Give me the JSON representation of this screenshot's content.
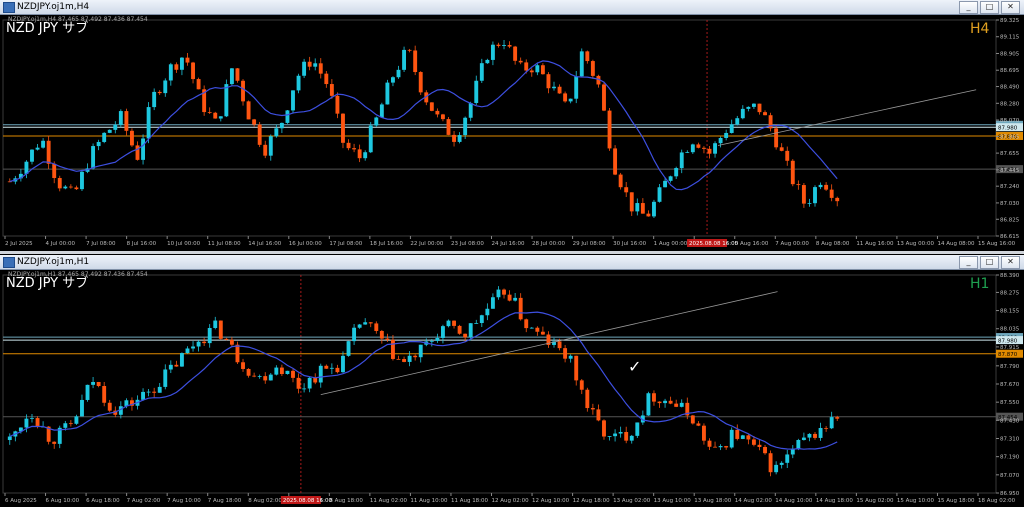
{
  "windows": [
    {
      "title": "NZDJPY.oj1m,H4",
      "buttons": [
        "_",
        "□",
        "✕"
      ],
      "chart_data": {
        "type": "candlestick",
        "info_line": "NZDJPY.oj1m,H4  87.465 87.492 87.436 87.454",
        "symbol_label": "NZD JPY サブ",
        "timeframe_label": "H4",
        "ylim": [
          86.615,
          89.325
        ],
        "y_ticks": [
          "89.325",
          "89.115",
          "88.905",
          "88.695",
          "88.490",
          "88.280",
          "88.070",
          "87.865",
          "87.655",
          "87.445",
          "87.240",
          "87.030",
          "86.825",
          "86.615"
        ],
        "x_ticks": [
          "2 Jul 2025",
          "4 Jul 00:00",
          "7 Jul 08:00",
          "8 Jul 16:00",
          "10 Jul 00:00",
          "11 Jul 08:00",
          "14 Jul 16:00",
          "16 Jul 00:00",
          "17 Jul 08:00",
          "18 Jul 16:00",
          "22 Jul 00:00",
          "23 Jul 08:00",
          "24 Jul 16:00",
          "28 Jul 00:00",
          "29 Jul 08:00",
          "30 Jul 16:00",
          "1 Aug 00:00",
          "4 Aug 08:00",
          "5 Aug 16:00",
          "7 Aug 00:00",
          "8 Aug 08:00",
          "11 Aug 16:00",
          "13 Aug 00:00",
          "14 Aug 08:00",
          "15 Aug 16:00"
        ],
        "cursor_time": "2025.08.08 16:00",
        "levels": [
          {
            "price": 88.01,
            "label": "88.010",
            "color": "#6fa8bd"
          },
          {
            "price": 87.98,
            "label": "87.980",
            "color": "#cfe8ee"
          },
          {
            "price": 87.87,
            "label": "87.870",
            "color": "#e08a00"
          },
          {
            "price": 87.454,
            "label": "87.454",
            "color": "#555555"
          }
        ],
        "anchors": [
          87.3,
          87.55,
          87.85,
          87.3,
          87.1,
          87.6,
          87.9,
          88.1,
          87.6,
          88.35,
          88.7,
          88.9,
          88.3,
          88.0,
          88.75,
          88.15,
          87.7,
          88.0,
          88.6,
          88.85,
          88.5,
          87.75,
          87.6,
          88.05,
          88.6,
          88.95,
          88.4,
          88.05,
          87.85,
          88.3,
          88.9,
          89.1,
          88.7,
          88.75,
          88.5,
          88.2,
          88.95,
          88.5,
          87.5,
          87.0,
          86.85,
          87.2,
          87.6,
          87.85,
          87.65,
          87.95,
          88.15,
          88.25,
          87.9,
          87.4,
          87.0,
          87.35,
          87.1
        ],
        "seed": 7,
        "ma_color": "#3d4fe0",
        "bull_color": "#1ec8e0",
        "bear_color": "#ff5511",
        "label_color": "#e0a020",
        "trendline": {
          "from": [
            0.72,
            87.75
          ],
          "to": [
            0.98,
            88.45
          ]
        }
      }
    },
    {
      "title": "NZDJPY.oj1m,H1",
      "buttons": [
        "_",
        "□",
        "✕"
      ],
      "chart_data": {
        "type": "candlestick",
        "info_line": "NZDJPY.oj1m,H1  87.465 87.492 87.436 87.454",
        "symbol_label": "NZD JPY サブ",
        "timeframe_label": "H1",
        "ylim": [
          86.95,
          88.39
        ],
        "y_ticks": [
          "88.390",
          "88.275",
          "88.155",
          "88.035",
          "87.915",
          "87.790",
          "87.670",
          "87.550",
          "87.430",
          "87.310",
          "87.190",
          "87.070",
          "86.950"
        ],
        "x_ticks": [
          "6 Aug 2025",
          "6 Aug 10:00",
          "6 Aug 18:00",
          "7 Aug 02:00",
          "7 Aug 10:00",
          "7 Aug 18:00",
          "8 Aug 02:00",
          "8 Aug 10:00",
          "8 Aug 18:00",
          "11 Aug 02:00",
          "11 Aug 10:00",
          "11 Aug 18:00",
          "12 Aug 02:00",
          "12 Aug 10:00",
          "12 Aug 18:00",
          "13 Aug 02:00",
          "13 Aug 10:00",
          "13 Aug 18:00",
          "14 Aug 02:00",
          "14 Aug 10:00",
          "14 Aug 18:00",
          "15 Aug 02:00",
          "15 Aug 10:00",
          "15 Aug 18:00",
          "18 Aug 02:00"
        ],
        "cursor_time": "2025.08.08 16:00",
        "levels": [
          {
            "price": 87.98,
            "label": "88.010",
            "color": "#6fa8bd"
          },
          {
            "price": 87.96,
            "label": "87.980",
            "color": "#cfe8ee"
          },
          {
            "price": 87.87,
            "label": "87.870",
            "color": "#e08a00"
          },
          {
            "price": 87.454,
            "label": "87.454",
            "color": "#555555"
          }
        ],
        "anchors": [
          87.3,
          87.5,
          87.3,
          87.4,
          87.7,
          87.5,
          87.55,
          87.65,
          87.8,
          87.95,
          88.05,
          87.85,
          87.7,
          87.8,
          87.65,
          87.75,
          87.8,
          88.1,
          87.95,
          87.8,
          87.9,
          88.05,
          88.0,
          88.15,
          88.3,
          88.05,
          87.95,
          87.85,
          87.5,
          87.3,
          87.35,
          87.6,
          87.55,
          87.45,
          87.2,
          87.35,
          87.25,
          87.1,
          87.25,
          87.35,
          87.45
        ],
        "seed": 13,
        "ma_color": "#3d4fe0",
        "bull_color": "#1ec8e0",
        "bear_color": "#ff5511",
        "label_color": "#1ea050",
        "trendline": {
          "from": [
            0.32,
            87.6
          ],
          "to": [
            0.78,
            88.28
          ]
        },
        "check_mark": "✓"
      }
    }
  ]
}
